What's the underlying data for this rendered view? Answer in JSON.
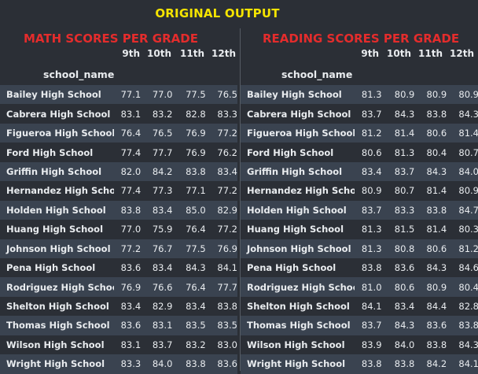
{
  "title": "ORIGINAL OUTPUT",
  "math": {
    "title": "MATH SCORES PER GRADE",
    "index_label": "school_name",
    "grades": [
      "9th",
      "10th",
      "11th",
      "12th"
    ],
    "rows": [
      {
        "school": "Bailey High School",
        "v": [
          "77.1",
          "77.0",
          "77.5",
          "76.5"
        ]
      },
      {
        "school": "Cabrera High School",
        "v": [
          "83.1",
          "83.2",
          "82.8",
          "83.3"
        ]
      },
      {
        "school": "Figueroa High School",
        "v": [
          "76.4",
          "76.5",
          "76.9",
          "77.2"
        ]
      },
      {
        "school": "Ford High School",
        "v": [
          "77.4",
          "77.7",
          "76.9",
          "76.2"
        ]
      },
      {
        "school": "Griffin High School",
        "v": [
          "82.0",
          "84.2",
          "83.8",
          "83.4"
        ]
      },
      {
        "school": "Hernandez High School",
        "v": [
          "77.4",
          "77.3",
          "77.1",
          "77.2"
        ]
      },
      {
        "school": "Holden High School",
        "v": [
          "83.8",
          "83.4",
          "85.0",
          "82.9"
        ]
      },
      {
        "school": "Huang High School",
        "v": [
          "77.0",
          "75.9",
          "76.4",
          "77.2"
        ]
      },
      {
        "school": "Johnson High School",
        "v": [
          "77.2",
          "76.7",
          "77.5",
          "76.9"
        ]
      },
      {
        "school": "Pena High School",
        "v": [
          "83.6",
          "83.4",
          "84.3",
          "84.1"
        ]
      },
      {
        "school": "Rodriguez High School",
        "v": [
          "76.9",
          "76.6",
          "76.4",
          "77.7"
        ]
      },
      {
        "school": "Shelton High School",
        "v": [
          "83.4",
          "82.9",
          "83.4",
          "83.8"
        ]
      },
      {
        "school": "Thomas High School",
        "v": [
          "83.6",
          "83.1",
          "83.5",
          "83.5"
        ]
      },
      {
        "school": "Wilson High School",
        "v": [
          "83.1",
          "83.7",
          "83.2",
          "83.0"
        ]
      },
      {
        "school": "Wright High School",
        "v": [
          "83.3",
          "84.0",
          "83.8",
          "83.6"
        ]
      }
    ]
  },
  "reading": {
    "title": "READING SCORES PER GRADE",
    "index_label": "school_name",
    "grades": [
      "9th",
      "10th",
      "11th",
      "12th"
    ],
    "rows": [
      {
        "school": "Bailey High School",
        "v": [
          "81.3",
          "80.9",
          "80.9",
          "80.9"
        ]
      },
      {
        "school": "Cabrera High School",
        "v": [
          "83.7",
          "84.3",
          "83.8",
          "84.3"
        ]
      },
      {
        "school": "Figueroa High School",
        "v": [
          "81.2",
          "81.4",
          "80.6",
          "81.4"
        ]
      },
      {
        "school": "Ford High School",
        "v": [
          "80.6",
          "81.3",
          "80.4",
          "80.7"
        ]
      },
      {
        "school": "Griffin High School",
        "v": [
          "83.4",
          "83.7",
          "84.3",
          "84.0"
        ]
      },
      {
        "school": "Hernandez High School",
        "v": [
          "80.9",
          "80.7",
          "81.4",
          "80.9"
        ]
      },
      {
        "school": "Holden High School",
        "v": [
          "83.7",
          "83.3",
          "83.8",
          "84.7"
        ]
      },
      {
        "school": "Huang High School",
        "v": [
          "81.3",
          "81.5",
          "81.4",
          "80.3"
        ]
      },
      {
        "school": "Johnson High School",
        "v": [
          "81.3",
          "80.8",
          "80.6",
          "81.2"
        ]
      },
      {
        "school": "Pena High School",
        "v": [
          "83.8",
          "83.6",
          "84.3",
          "84.6"
        ]
      },
      {
        "school": "Rodriguez High School",
        "v": [
          "81.0",
          "80.6",
          "80.9",
          "80.4"
        ]
      },
      {
        "school": "Shelton High School",
        "v": [
          "84.1",
          "83.4",
          "84.4",
          "82.8"
        ]
      },
      {
        "school": "Thomas High School",
        "v": [
          "83.7",
          "84.3",
          "83.6",
          "83.8"
        ]
      },
      {
        "school": "Wilson High School",
        "v": [
          "83.9",
          "84.0",
          "83.8",
          "84.3"
        ]
      },
      {
        "school": "Wright High School",
        "v": [
          "83.8",
          "83.8",
          "84.2",
          "84.1"
        ]
      }
    ]
  }
}
